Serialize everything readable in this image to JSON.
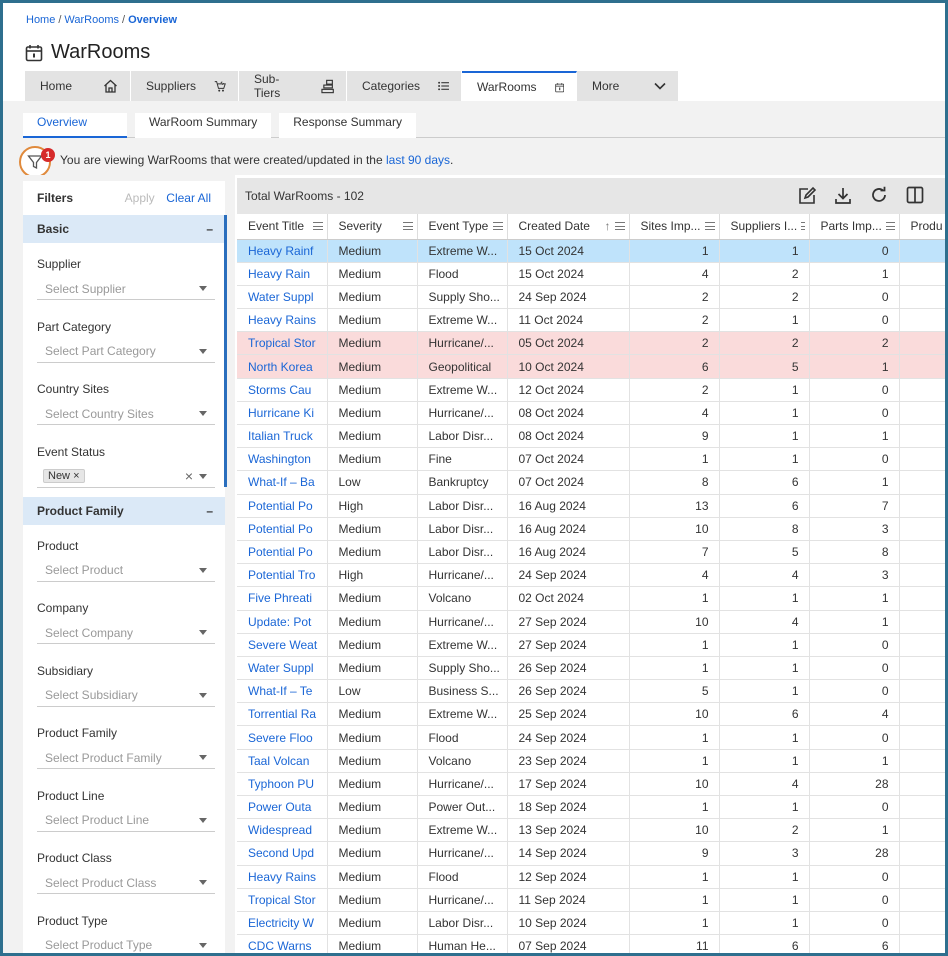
{
  "breadcrumb": {
    "home": "Home",
    "section": "WarRooms",
    "current": "Overview"
  },
  "page": {
    "title": "WarRooms"
  },
  "nav": [
    {
      "label": "Home",
      "icon": "home-icon"
    },
    {
      "label": "Suppliers",
      "icon": "suppliers-icon"
    },
    {
      "label": "Sub-Tiers",
      "icon": "sub-tiers-icon"
    },
    {
      "label": "Categories",
      "icon": "list-icon"
    },
    {
      "label": "WarRooms",
      "icon": "calendar-icon"
    },
    {
      "label": "More",
      "icon": "chevron-down-icon"
    }
  ],
  "subtabs": [
    "Overview",
    "WarRoom Summary",
    "Response Summary"
  ],
  "info": {
    "prefix": "You are viewing WarRooms that were created/updated in the",
    "link": "last 90 days",
    "suffix": ".",
    "filter_count": "1"
  },
  "filters": {
    "title": "Filters",
    "apply": "Apply",
    "clear": "Clear All",
    "basic": {
      "title": "Basic",
      "collapse": "–",
      "supplier": {
        "label": "Supplier",
        "placeholder": "Select Supplier"
      },
      "part_category": {
        "label": "Part Category",
        "placeholder": "Select Part Category"
      },
      "country_sites": {
        "label": "Country Sites",
        "placeholder": "Select Country Sites"
      },
      "event_status": {
        "label": "Event Status",
        "chip": "New",
        "chip_remove": "×",
        "clear": "×"
      }
    },
    "product_family_section": {
      "title": "Product Family",
      "collapse": "–",
      "product": {
        "label": "Product",
        "placeholder": "Select Product"
      },
      "company": {
        "label": "Company",
        "placeholder": "Select Company"
      },
      "subsidiary": {
        "label": "Subsidiary",
        "placeholder": "Select Subsidiary"
      },
      "product_family": {
        "label": "Product Family",
        "placeholder": "Select Product Family"
      },
      "product_line": {
        "label": "Product Line",
        "placeholder": "Select Product Line"
      },
      "product_class": {
        "label": "Product Class",
        "placeholder": "Select Product Class"
      },
      "product_type": {
        "label": "Product Type",
        "placeholder": "Select Product Type"
      }
    }
  },
  "grid": {
    "total": "Total WarRooms - 102",
    "sort_icon": "↑",
    "columns": [
      "Event Title",
      "Severity",
      "Event Type",
      "Created Date",
      "Sites Imp...",
      "Suppliers I...",
      "Parts Imp...",
      "Produ"
    ],
    "rows": [
      [
        "Heavy Rainf",
        "Medium",
        "Extreme W...",
        "15 Oct 2024",
        "1",
        "1",
        "0"
      ],
      [
        "Heavy Rain",
        "Medium",
        "Flood",
        "15 Oct 2024",
        "4",
        "2",
        "1"
      ],
      [
        "Water Suppl",
        "Medium",
        "Supply Sho...",
        "24 Sep 2024",
        "2",
        "2",
        "0"
      ],
      [
        "Heavy Rains",
        "Medium",
        "Extreme W...",
        "11 Oct 2024",
        "2",
        "1",
        "0"
      ],
      [
        "Tropical Stor",
        "Medium",
        "Hurricane/...",
        "05 Oct 2024",
        "2",
        "2",
        "2"
      ],
      [
        "North Korea",
        "Medium",
        "Geopolitical",
        "10 Oct 2024",
        "6",
        "5",
        "1"
      ],
      [
        "Storms Cau",
        "Medium",
        "Extreme W...",
        "12 Oct 2024",
        "2",
        "1",
        "0"
      ],
      [
        "Hurricane Ki",
        "Medium",
        "Hurricane/...",
        "08 Oct 2024",
        "4",
        "1",
        "0"
      ],
      [
        "Italian Truck",
        "Medium",
        "Labor Disr...",
        "08 Oct 2024",
        "9",
        "1",
        "1"
      ],
      [
        "Washington",
        "Medium",
        "Fine",
        "07 Oct 2024",
        "1",
        "1",
        "0"
      ],
      [
        "What-If – Ba",
        "Low",
        "Bankruptcy",
        "07 Oct 2024",
        "8",
        "6",
        "1"
      ],
      [
        "Potential Po",
        "High",
        "Labor Disr...",
        "16 Aug 2024",
        "13",
        "6",
        "7"
      ],
      [
        "Potential Po",
        "Medium",
        "Labor Disr...",
        "16 Aug 2024",
        "10",
        "8",
        "3"
      ],
      [
        "Potential Po",
        "Medium",
        "Labor Disr...",
        "16 Aug 2024",
        "7",
        "5",
        "8"
      ],
      [
        "Potential Tro",
        "High",
        "Hurricane/...",
        "24 Sep 2024",
        "4",
        "4",
        "3"
      ],
      [
        "Five Phreati",
        "Medium",
        "Volcano",
        "02 Oct 2024",
        "1",
        "1",
        "1"
      ],
      [
        "Update: Pot",
        "Medium",
        "Hurricane/...",
        "27 Sep 2024",
        "10",
        "4",
        "1"
      ],
      [
        "Severe Weat",
        "Medium",
        "Extreme W...",
        "27 Sep 2024",
        "1",
        "1",
        "0"
      ],
      [
        "Water Suppl",
        "Medium",
        "Supply Sho...",
        "26 Sep 2024",
        "1",
        "1",
        "0"
      ],
      [
        "What-If – Te",
        "Low",
        "Business S...",
        "26 Sep 2024",
        "5",
        "1",
        "0"
      ],
      [
        "Torrential Ra",
        "Medium",
        "Extreme W...",
        "25 Sep 2024",
        "10",
        "6",
        "4"
      ],
      [
        "Severe Floo",
        "Medium",
        "Flood",
        "24 Sep 2024",
        "1",
        "1",
        "0"
      ],
      [
        "Taal Volcan",
        "Medium",
        "Volcano",
        "23 Sep 2024",
        "1",
        "1",
        "1"
      ],
      [
        "Typhoon PU",
        "Medium",
        "Hurricane/...",
        "17 Sep 2024",
        "10",
        "4",
        "28"
      ],
      [
        "Power Outa",
        "Medium",
        "Power Out...",
        "18 Sep 2024",
        "1",
        "1",
        "0"
      ],
      [
        "Widespread",
        "Medium",
        "Extreme W...",
        "13 Sep 2024",
        "10",
        "2",
        "1"
      ],
      [
        "Second Upd",
        "Medium",
        "Hurricane/...",
        "14 Sep 2024",
        "9",
        "3",
        "28"
      ],
      [
        "Heavy Rains",
        "Medium",
        "Flood",
        "12 Sep 2024",
        "1",
        "1",
        "0"
      ],
      [
        "Tropical Stor",
        "Medium",
        "Hurricane/...",
        "11 Sep 2024",
        "1",
        "1",
        "0"
      ],
      [
        "Electricity W",
        "Medium",
        "Labor Disr...",
        "10 Sep 2024",
        "1",
        "1",
        "0"
      ],
      [
        "CDC Warns",
        "Medium",
        "Human He...",
        "07 Sep 2024",
        "11",
        "6",
        "6"
      ]
    ]
  }
}
